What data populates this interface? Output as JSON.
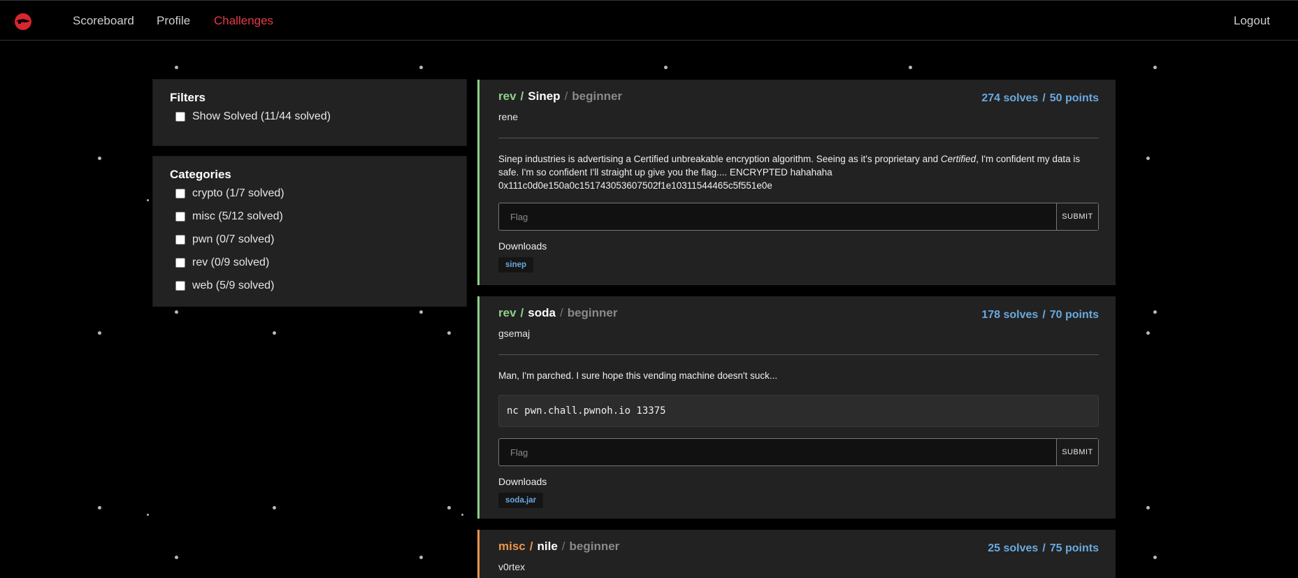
{
  "nav": {
    "logo_icon": "flag-logo-icon",
    "links": [
      "Scoreboard",
      "Profile",
      "Challenges"
    ],
    "active": "Challenges",
    "logout": "Logout"
  },
  "filters": {
    "title": "Filters",
    "show_solved": "Show Solved (11/44 solved)"
  },
  "categories": {
    "title": "Categories",
    "items": [
      "crypto (1/7 solved)",
      "misc (5/12 solved)",
      "pwn (0/7 solved)",
      "rev (0/9 solved)",
      "web (5/9 solved)"
    ]
  },
  "challenges": [
    {
      "category": "rev",
      "name": "Sinep",
      "difficulty": "beginner",
      "solves": "274 solves",
      "points": "50 points",
      "author": "rene",
      "desc_pre": "Sinep industries is advertising a Certified unbreakable encryption algorithm. Seeing as it's proprietary and ",
      "desc_em": "Certified",
      "desc_post": ", I'm confident my data is safe. I'm so confident I'll straight up give you the flag.... ENCRYPTED hahahaha 0x111c0d0e150a0c151743053607502f1e10311544465c5f551e0e",
      "flag_placeholder": "Flag",
      "submit": "SUBMIT",
      "downloads_label": "Downloads",
      "download": "sinep",
      "accent": "#8fd18a"
    },
    {
      "category": "rev",
      "name": "soda",
      "difficulty": "beginner",
      "solves": "178 solves",
      "points": "70 points",
      "author": "gsemaj",
      "desc": "Man, I'm parched. I sure hope this vending machine doesn't suck...",
      "code": "nc pwn.chall.pwnoh.io 13375",
      "flag_placeholder": "Flag",
      "submit": "SUBMIT",
      "downloads_label": "Downloads",
      "download": "soda.jar",
      "accent": "#8fd18a"
    },
    {
      "category": "misc",
      "name": "nile",
      "difficulty": "beginner",
      "solves": "25 solves",
      "points": "75 points",
      "author": "v0rtex",
      "accent": "#e8964a"
    }
  ],
  "colors": {
    "active_nav": "#e63a46",
    "stats": "#6aa9e0",
    "rev": "#8fd18a",
    "misc": "#e8964a",
    "card_bg": "#222222"
  }
}
